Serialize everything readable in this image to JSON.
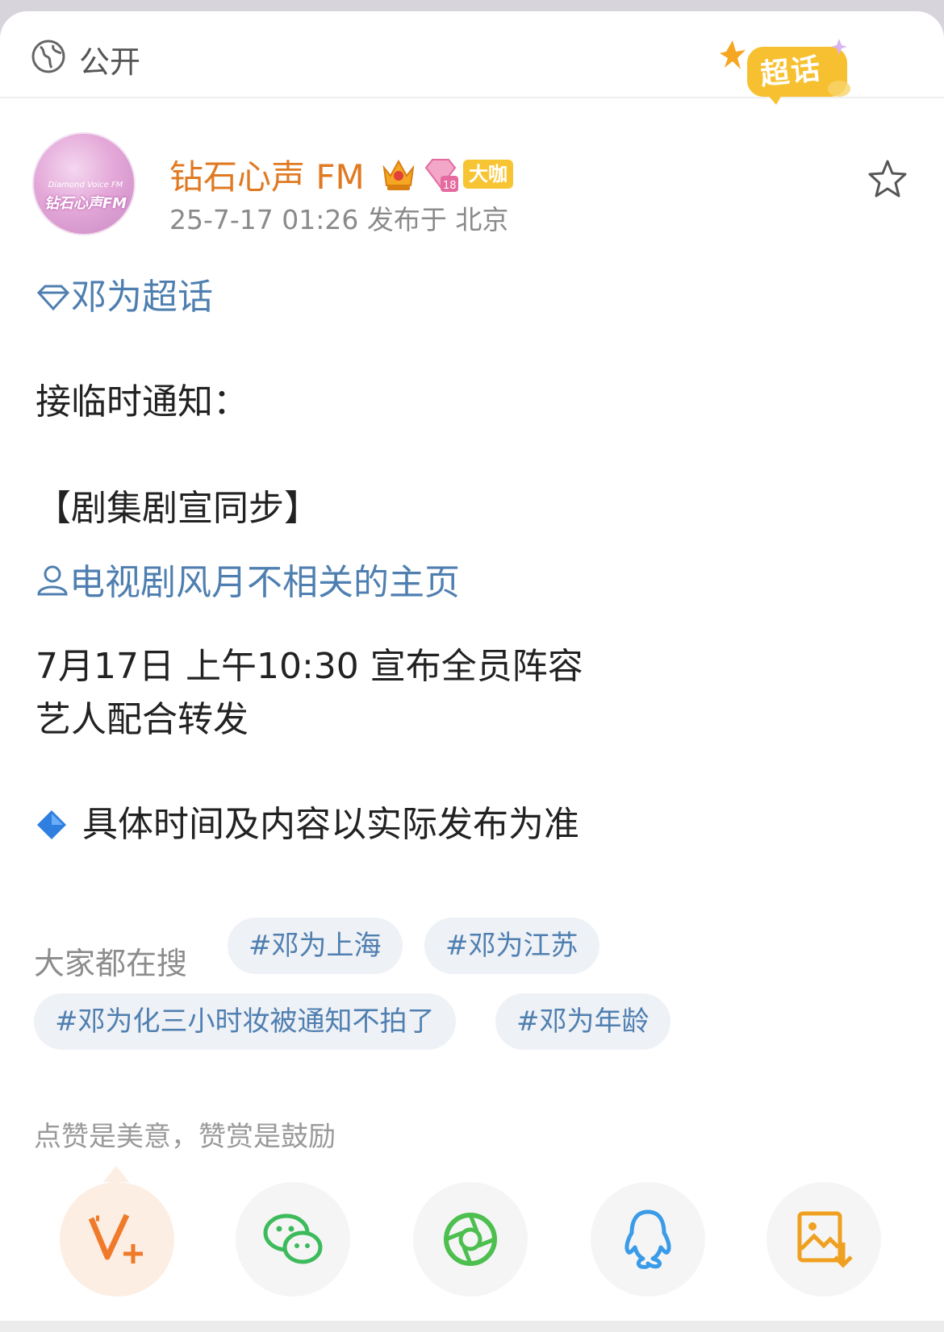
{
  "header": {
    "visibility": "公开",
    "supertopic_badge": "超话"
  },
  "author": {
    "name": "钻石心声 FM",
    "avatar_text_en": "Diamond Voice FM",
    "avatar_text_zh": "钻石心声FM",
    "crown_level": "4",
    "diamond_level": "18",
    "badge": "大咖",
    "meta": "25-7-17 01:26  发布于 北京"
  },
  "post": {
    "topic": "邓为超话",
    "line1": "接临时通知：",
    "line2": "【剧集剧宣同步】",
    "user_link": "电视剧风月不相关的主页",
    "line3": "7月17日 上午10:30 宣布全员阵容",
    "line4": "艺人配合转发",
    "line5": "具体时间及内容以实际发布为准"
  },
  "search": {
    "label": "大家都在搜",
    "tags": [
      "#邓为上海",
      "#邓为江苏",
      "#邓为化三小时妆被通知不拍了",
      "#邓为年龄"
    ]
  },
  "reward": {
    "text": "点赞是美意，赞赏是鼓励"
  },
  "colors": {
    "accent_orange": "#e07a22",
    "link_blue": "#4f7fb0",
    "wechat_green": "#3dbb5c",
    "moments_green": "#4cbf4f",
    "qq_blue": "#3a9be8"
  },
  "share": {
    "icons": [
      "v-plus-icon",
      "wechat-icon",
      "moments-icon",
      "qq-icon",
      "save-image-icon"
    ]
  }
}
